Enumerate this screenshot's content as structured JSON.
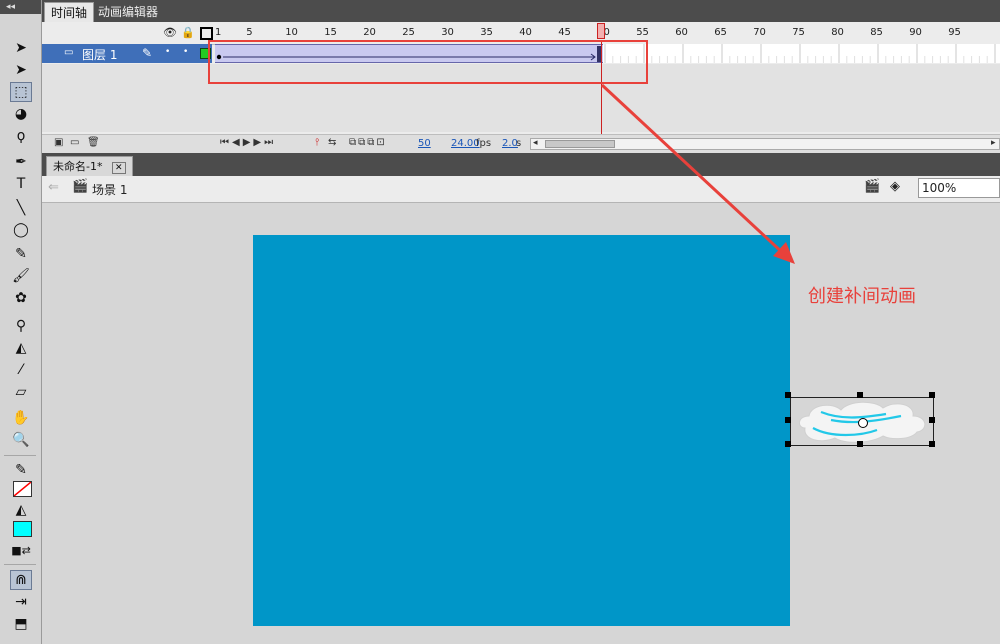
{
  "toolbar": {
    "grip_label": "◂◂",
    "tools": [
      {
        "name": "selection-tool",
        "glyph": "➤"
      },
      {
        "name": "subselection-tool",
        "glyph": "➤"
      },
      {
        "name": "free-transform-tool",
        "glyph": "⬚"
      },
      {
        "name": "3d-rotation-tool",
        "glyph": "◕"
      },
      {
        "name": "lasso-tool",
        "glyph": "ϙ"
      },
      {
        "name": "pen-tool",
        "glyph": "✒"
      },
      {
        "name": "text-tool",
        "glyph": "T"
      },
      {
        "name": "line-tool",
        "glyph": "╲"
      },
      {
        "name": "oval-tool",
        "glyph": "◯"
      },
      {
        "name": "pencil-tool",
        "glyph": "✎"
      },
      {
        "name": "brush-tool",
        "glyph": "🖌"
      },
      {
        "name": "deco-tool",
        "glyph": "✿"
      },
      {
        "name": "bone-tool",
        "glyph": "⚲"
      },
      {
        "name": "paint-bucket-tool",
        "glyph": "◭"
      },
      {
        "name": "eyedropper-tool",
        "glyph": "⁄"
      },
      {
        "name": "eraser-tool",
        "glyph": "▱"
      },
      {
        "name": "hand-tool",
        "glyph": "✋"
      },
      {
        "name": "zoom-tool",
        "glyph": "🔍"
      }
    ],
    "stroke_color": "#ff0000",
    "fill_color": "#00ffff"
  },
  "tabs": {
    "timeline": "时间轴",
    "motion_editor": "动画编辑器"
  },
  "timeline": {
    "frame_numbers": [
      "1",
      "5",
      "10",
      "15",
      "20",
      "25",
      "30",
      "35",
      "40",
      "45",
      "50",
      "55",
      "60",
      "65",
      "70",
      "75",
      "80",
      "85",
      "90",
      "95"
    ],
    "layer_name": "图层 1",
    "status": {
      "current_frame": "50",
      "fps": "24.00",
      "fps_unit": "fps",
      "elapsed": "2.0",
      "elapsed_unit": "s"
    }
  },
  "document": {
    "tab_title": "未命名-1*",
    "scene_name": "场景 1",
    "zoom": "100%"
  },
  "annotation": {
    "label": "创建补间动画",
    "color": "#e8413b"
  },
  "colors": {
    "stage": "#0096c8",
    "layer_selected": "#3f6fb9",
    "tween_span": "#c9c9f0"
  }
}
